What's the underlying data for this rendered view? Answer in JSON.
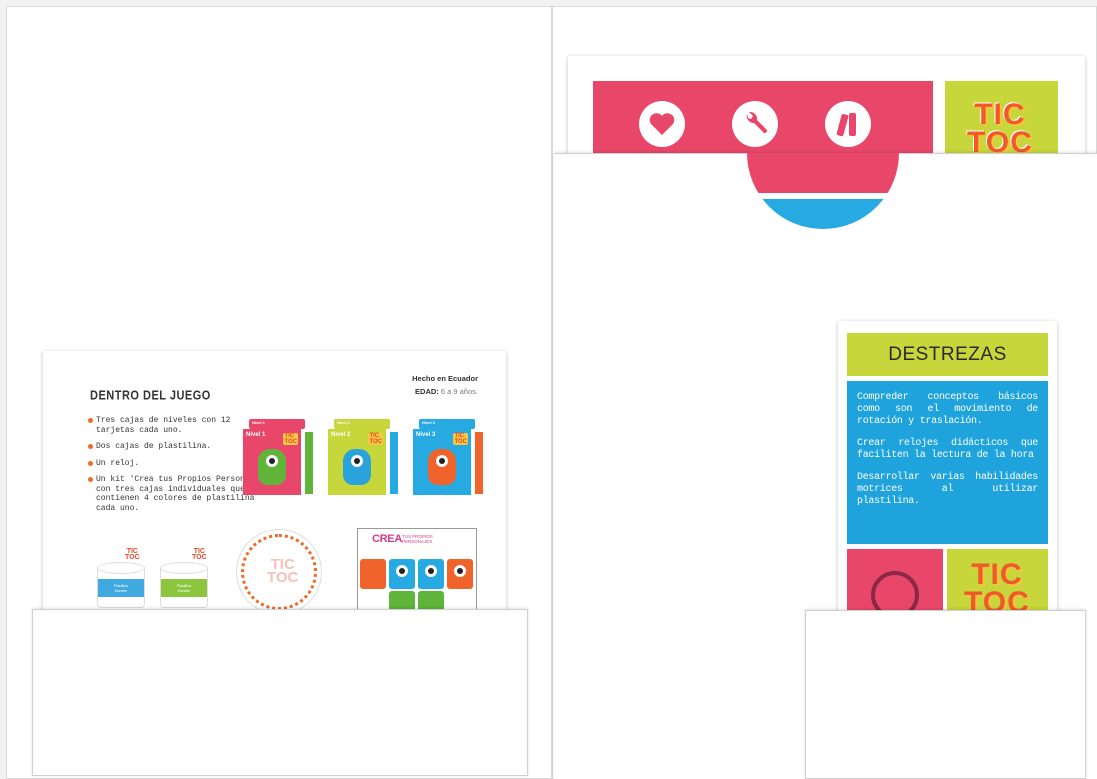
{
  "inner": {
    "title": "DENTRO DEL JUEGO",
    "made_in": "Hecho en Ecuador",
    "age_label": "EDAD:",
    "age_value": "6 a 9 años.",
    "items": [
      "Tres cajas de niveles con 12 tarjetas cada uno.",
      "Dos cajas de plastilina.",
      "Un reloj.",
      "Un kit 'Crea tus Propios Personajes' con tres cajas individuales que contienen 4 colores de plastilina cada uno."
    ],
    "boxes": [
      {
        "lid": "Nivel 1",
        "front": "Nivel 1",
        "color": "#e9476a",
        "monster": "#5fb53a"
      },
      {
        "lid": "Nivel 2",
        "front": "Nivel 2",
        "color": "#c7d63a",
        "monster": "#2aa3dc"
      },
      {
        "lid": "Nivel 3",
        "front": "Nivel 3",
        "color": "#27a9e1",
        "monster": "#f0632a"
      }
    ],
    "jars": [
      {
        "label1": "Plastilina",
        "label2": "Monster",
        "color": "#3fa9e0"
      },
      {
        "label1": "Plastilina",
        "label2": "Monster",
        "color": "#8cc63f"
      }
    ],
    "logo": "TIC TOC",
    "kit_title": "CREA",
    "kit_sub1": "TUS PROPIOS",
    "kit_sub2": "PERSONAJES"
  },
  "cover": {
    "logo_line1": "TIC",
    "logo_line2": "TOC"
  },
  "destrezas": {
    "title": "DESTREZAS",
    "paragraphs": [
      "Compreder conceptos básicos como son el movimiento de rotación y traslación.",
      "Crear relojes didácticos que faciliten la lectura de la hora",
      "Desarrollar varias habilidades motrices al utilizar plastilina."
    ],
    "logo_line1": "TIC",
    "logo_line2": "TOC"
  },
  "colors": {
    "pink": "#e9476a",
    "lime": "#c7d63a",
    "blue": "#1fa3dc",
    "orange": "#f06a25"
  },
  "icons": [
    "heart-icon",
    "wrench-icon",
    "books-icon",
    "alarm-clock-icon"
  ]
}
